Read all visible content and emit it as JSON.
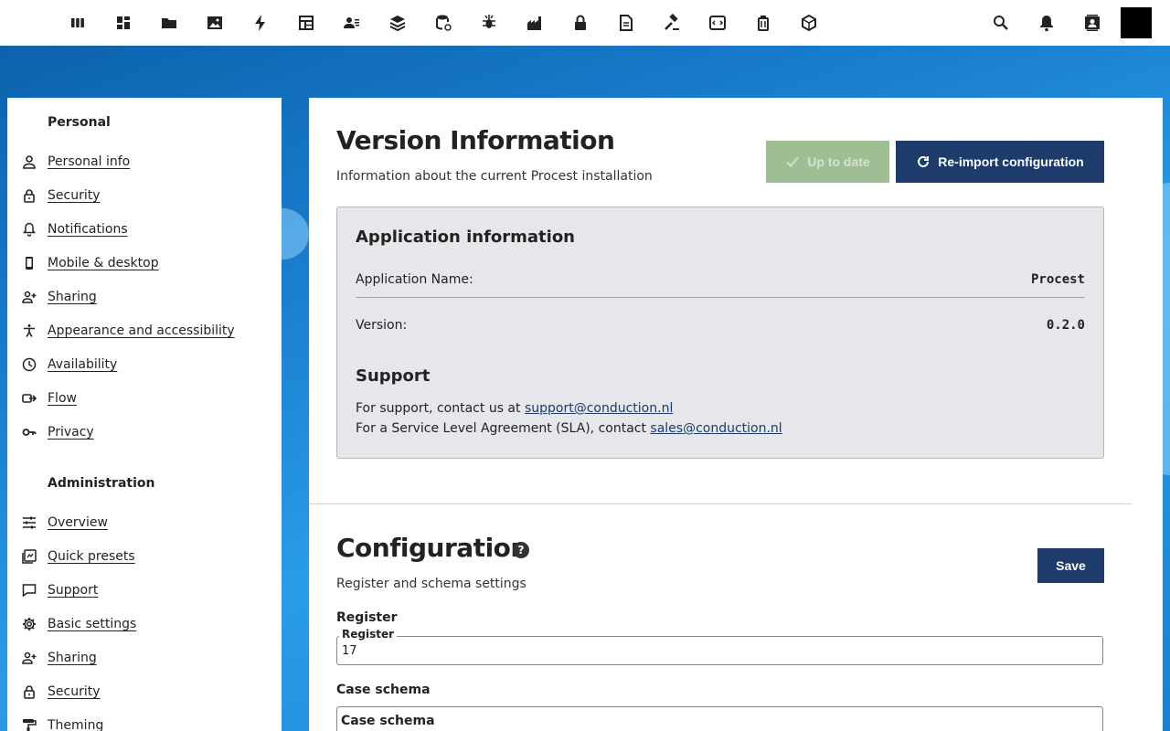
{
  "top_apps": [
    {
      "name": "dashboard-columns-icon"
    },
    {
      "name": "dashboard-grid-icon"
    },
    {
      "name": "files-folder-icon"
    },
    {
      "name": "photos-image-icon"
    },
    {
      "name": "activity-lightning-icon"
    },
    {
      "name": "tables-icon"
    },
    {
      "name": "contacts-icon"
    },
    {
      "name": "layers-icon"
    },
    {
      "name": "database-icon"
    },
    {
      "name": "bug-icon"
    },
    {
      "name": "factory-icon"
    },
    {
      "name": "lock-icon"
    },
    {
      "name": "document-icon"
    },
    {
      "name": "gavel-icon"
    },
    {
      "name": "code-icon"
    },
    {
      "name": "trash-icon"
    },
    {
      "name": "package-icon"
    }
  ],
  "top_right": {
    "search": "search-icon",
    "notifications": "notifications-bell-icon",
    "contacts": "contacts-menu-icon"
  },
  "sidebar": {
    "personal_title": "Personal",
    "personal_items": [
      {
        "label": "Personal info",
        "icon": "user-icon"
      },
      {
        "label": "Security",
        "icon": "lock-icon"
      },
      {
        "label": "Notifications",
        "icon": "bell-icon"
      },
      {
        "label": "Mobile & desktop",
        "icon": "phone-icon"
      },
      {
        "label": "Sharing",
        "icon": "share-user-icon"
      },
      {
        "label": "Appearance and accessibility",
        "icon": "accessibility-icon"
      },
      {
        "label": "Availability",
        "icon": "clock-icon"
      },
      {
        "label": "Flow",
        "icon": "flow-icon"
      },
      {
        "label": "Privacy",
        "icon": "key-icon"
      }
    ],
    "admin_title": "Administration",
    "admin_items": [
      {
        "label": "Overview",
        "icon": "sliders-icon"
      },
      {
        "label": "Quick presets",
        "icon": "presets-icon"
      },
      {
        "label": "Support",
        "icon": "chat-icon"
      },
      {
        "label": "Basic settings",
        "icon": "gear-icon"
      },
      {
        "label": "Sharing",
        "icon": "share-user-icon"
      },
      {
        "label": "Security",
        "icon": "lock-icon"
      },
      {
        "label": "Theming",
        "icon": "paint-roller-icon"
      }
    ]
  },
  "version": {
    "title": "Version Information",
    "subtitle": "Information about the current Procest installation",
    "uptodate_label": "Up to date",
    "reimport_label": "Re-import configuration",
    "app_info_title": "Application information",
    "app_name_label": "Application Name:",
    "app_name_value": "Procest",
    "version_label": "Version:",
    "version_value": "0.2.0",
    "support_title": "Support",
    "support_prefix": "For support, contact us at ",
    "support_email": "support@conduction.nl",
    "sla_prefix": "For a Service Level Agreement (SLA), contact ",
    "sla_email": "sales@conduction.nl"
  },
  "configuration": {
    "title": "Configuration",
    "subtitle": "Register and schema settings",
    "save_label": "Save",
    "register_label": "Register",
    "register_legend": "Register",
    "register_value": "17",
    "case_schema_label": "Case schema",
    "case_schema_legend": "Case schema"
  },
  "colors": {
    "primary": "#1d3b6b",
    "uptodate_bg": "#9fbe94",
    "background_blue": "#1b7fd0"
  }
}
